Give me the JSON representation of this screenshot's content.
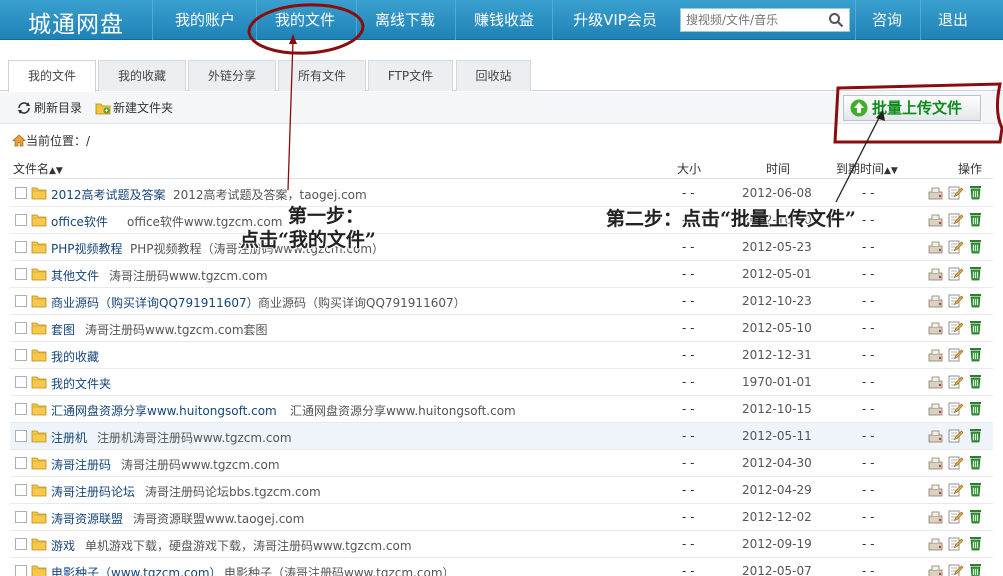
{
  "logo": "城通网盘",
  "nav": {
    "items": [
      "我的账户",
      "我的文件",
      "离线下载",
      "赚钱收益",
      "升级VIP会员"
    ],
    "search_placeholder": "搜视频/文件/音乐",
    "consult": "咨询",
    "logout": "退出"
  },
  "tabs": [
    "我的文件",
    "我的收藏",
    "外链分享",
    "所有文件",
    "FTP文件",
    "回收站"
  ],
  "toolbar": {
    "refresh": "刷新目录",
    "new_folder": "新建文件夹",
    "upload": "批量上传文件"
  },
  "location": "当前位置：/",
  "table": {
    "headers": {
      "name": "文件名",
      "size": "大小",
      "time": "时间",
      "expire": "到期时间",
      "ops": "操作"
    },
    "rows": [
      {
        "name": "2012高考试题及答案",
        "desc": "2012高考试题及答案，taogej.com",
        "size": "- -",
        "date": "2012-06-08",
        "expire": "- -"
      },
      {
        "name": "office软件",
        "desc": "office软件www.tgzcm.com",
        "size": "- -",
        "date": "2012-10-10",
        "expire": "- -"
      },
      {
        "name": "PHP视频教程",
        "desc": "PHP视频教程（涛哥注册码www.tgzcm.com）",
        "size": "- -",
        "date": "2012-05-23",
        "expire": "- -"
      },
      {
        "name": "其他文件",
        "desc": "涛哥注册码www.tgzcm.com",
        "size": "- -",
        "date": "2012-05-01",
        "expire": "- -"
      },
      {
        "name": "商业源码（购买详询QQ791911607）",
        "desc": "商业源码（购买详询QQ791911607）",
        "size": "- -",
        "date": "2012-10-23",
        "expire": "- -"
      },
      {
        "name": "套图",
        "desc": "涛哥注册码www.tgzcm.com套图",
        "size": "- -",
        "date": "2012-05-10",
        "expire": "- -"
      },
      {
        "name": "我的收藏",
        "desc": "",
        "size": "- -",
        "date": "2012-12-31",
        "expire": "- -"
      },
      {
        "name": "我的文件夹",
        "desc": "",
        "size": "- -",
        "date": "1970-01-01",
        "expire": "- -"
      },
      {
        "name": "汇通网盘资源分享www.huitongsoft.com",
        "desc": "汇通网盘资源分享www.huitongsoft.com",
        "size": "- -",
        "date": "2012-10-15",
        "expire": "- -"
      },
      {
        "name": "注册机",
        "desc": "注册机涛哥注册码www.tgzcm.com",
        "size": "- -",
        "date": "2012-05-11",
        "expire": "- -"
      },
      {
        "name": "涛哥注册码",
        "desc": "涛哥注册码www.tgzcm.com",
        "size": "- -",
        "date": "2012-04-30",
        "expire": "- -"
      },
      {
        "name": "涛哥注册码论坛",
        "desc": "涛哥注册码论坛bbs.tgzcm.com",
        "size": "- -",
        "date": "2012-04-29",
        "expire": "- -"
      },
      {
        "name": "涛哥资源联盟",
        "desc": "涛哥资源联盟www.taogej.com",
        "size": "- -",
        "date": "2012-12-02",
        "expire": "- -"
      },
      {
        "name": "游戏",
        "desc": "单机游戏下载，硬盘游戏下载，涛哥注册码www.tgzcm.com",
        "size": "- -",
        "date": "2012-09-19",
        "expire": "- -"
      },
      {
        "name": "电影种子（www.tgzcm.com）",
        "desc": "电影种子（涛哥注册码www.tgzcm.com）",
        "size": "- -",
        "date": "2012-05-07",
        "expire": "- -"
      }
    ]
  },
  "annotations": {
    "step1_title": "第一步：",
    "step1_text": "点击“我的文件”",
    "step2_text": "第二步：点击“批量上传文件”"
  },
  "colors": {
    "nav_bg": "#2a8fc2",
    "link": "#15467a",
    "upload_green": "#0d8a1c",
    "annot_red": "#8a0d0d"
  }
}
